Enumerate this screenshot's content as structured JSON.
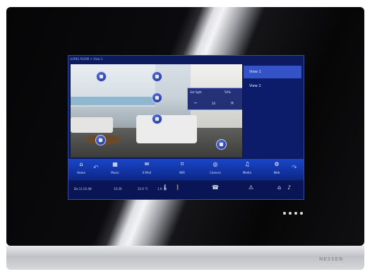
{
  "device": {
    "brand": "NESSEN"
  },
  "screen": {
    "breadcrumb": "LIVING ROOM > View 1",
    "popup": {
      "title": "Set light",
      "value": "50%",
      "minus": "−",
      "plus": "+",
      "reading": "20"
    },
    "views": [
      {
        "label": "View 1"
      },
      {
        "label": "View 2"
      }
    ],
    "toolbar": {
      "left_arrow": "↶",
      "right_arrow": "↷",
      "items": [
        {
          "icon": "home-icon",
          "glyph": "⌂",
          "label": "Home"
        },
        {
          "icon": "scene-icon",
          "glyph": "▦",
          "label": "Music"
        },
        {
          "icon": "mail-icon",
          "glyph": "✉",
          "label": "E-Mail"
        },
        {
          "icon": "wifi-icon",
          "glyph": "⌑",
          "label": "WiFi"
        },
        {
          "icon": "camera-icon",
          "glyph": "◎",
          "label": "Camera"
        },
        {
          "icon": "media-icon",
          "glyph": "♫",
          "label": "Media"
        },
        {
          "icon": "gear-icon",
          "glyph": "⚙",
          "label": "Web"
        }
      ]
    },
    "statusbar": {
      "date": "Do 11.01.08",
      "time": "15:20",
      "temp": "22.0 °C",
      "outdoor": "1.0"
    }
  },
  "colors": {
    "screen_bg": "#0d1a5e",
    "accent": "#3553c9"
  }
}
